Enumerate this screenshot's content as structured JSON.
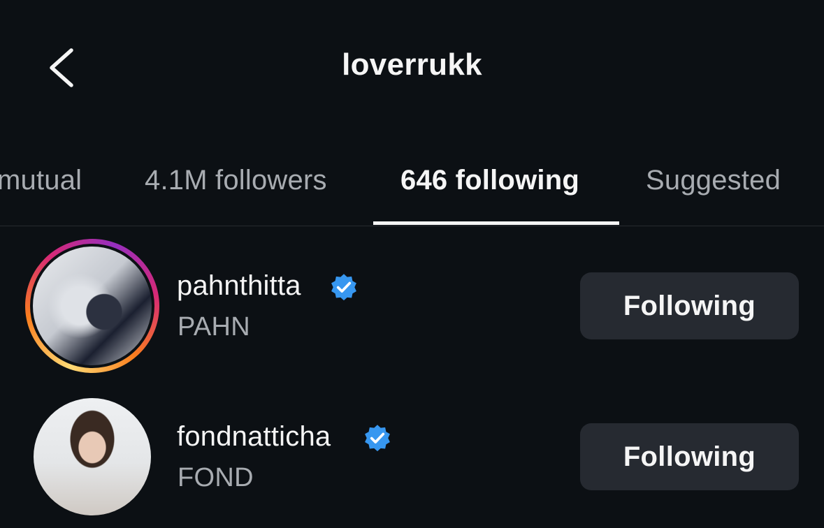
{
  "header": {
    "back_icon": "chevron-left-icon",
    "title": "loverrukk"
  },
  "tabs": [
    {
      "label": "mutual",
      "active": false
    },
    {
      "label": "4.1M followers",
      "active": false
    },
    {
      "label": "646 following",
      "active": true
    },
    {
      "label": "Suggested",
      "active": false
    }
  ],
  "accounts": [
    {
      "username": "pahnthitta",
      "verified": true,
      "full_name": "PAHN",
      "has_story_ring": true,
      "button_label": "Following"
    },
    {
      "username": "fondnatticha",
      "verified": true,
      "full_name": "FOND",
      "has_story_ring": false,
      "button_label": "Following"
    }
  ],
  "colors": {
    "background": "#0c1014",
    "verified_blue": "#3797f0",
    "button_bg": "#262a31",
    "secondary_text": "#a8acb1"
  }
}
